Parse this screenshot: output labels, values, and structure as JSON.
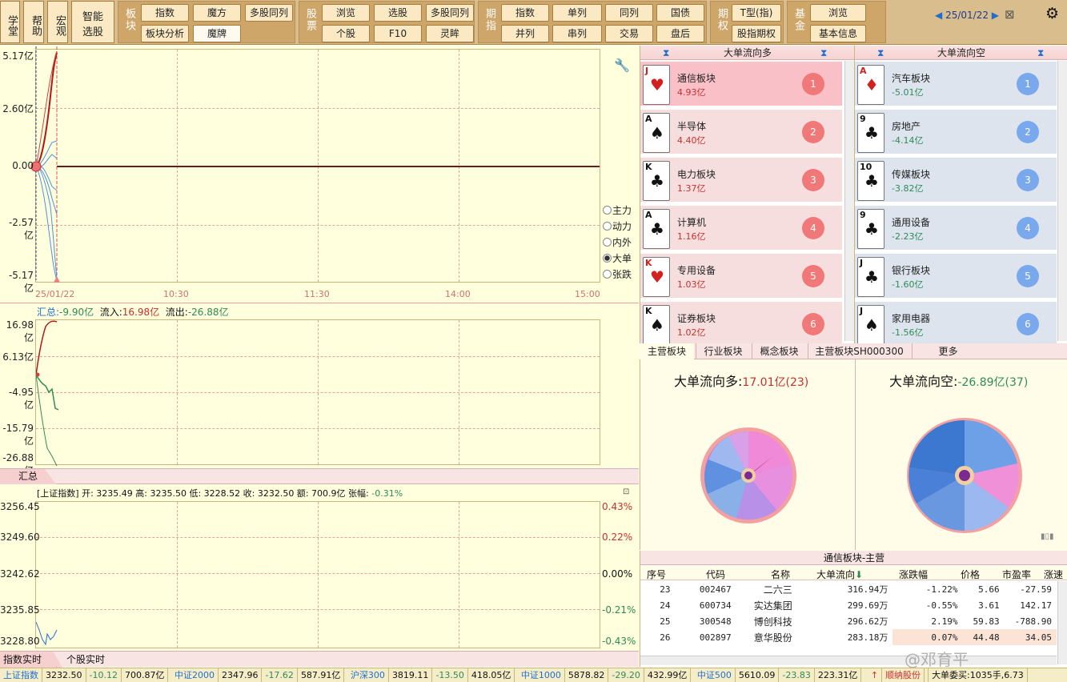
{
  "toolbar": {
    "left_buttons": [
      {
        "label": "学堂"
      },
      {
        "label": "帮助"
      },
      {
        "label": "宏观"
      },
      {
        "label": "智能选股"
      }
    ],
    "groups": {
      "bankuai": {
        "label": "板块",
        "buttons": [
          "指数",
          "魔方",
          "多股同列",
          "板块分析",
          "魔牌"
        ]
      },
      "gupiao": {
        "label": "股票",
        "buttons": [
          "浏览",
          "选股",
          "多股同列",
          "个股",
          "F10",
          "灵眸"
        ]
      },
      "qizhi": {
        "label": "期指",
        "buttons": [
          "指数",
          "单列",
          "同列",
          "国债",
          "并列",
          "串列",
          "交易",
          "盘后"
        ]
      },
      "qiquan": {
        "label": "期权",
        "buttons": [
          "T型(指)",
          "股指期权"
        ]
      },
      "jijin": {
        "label": "基金",
        "buttons": [
          "浏览",
          "基本信息"
        ]
      }
    },
    "date": "25/01/22"
  },
  "main_chart": {
    "y_labels": [
      "5.17亿",
      "2.60亿",
      "0.00",
      "-2.57亿",
      "-5.17亿"
    ],
    "x_labels": [
      "25/01/22",
      "10:30",
      "11:30",
      "14:00",
      "15:00"
    ],
    "radio_options": [
      "主力",
      "动力",
      "内外",
      "大单",
      "张跌"
    ],
    "selected_radio": "大单"
  },
  "flow_chart": {
    "summary_label": "汇总:",
    "summary_value": "-9.90亿",
    "inflow_label": "流入:",
    "inflow_value": "16.98亿",
    "outflow_label": "流出:",
    "outflow_value": "-26.88亿",
    "y_labels": [
      "16.98亿",
      "6.13亿",
      "-4.95亿",
      "-15.79亿",
      "-26.88亿"
    ],
    "tab_label": "汇总"
  },
  "index_chart": {
    "info": "[上证指数] 开: 3235.49  高: 3235.50  低: 3228.52  收: 3232.50  额: 700.9亿  张幅:",
    "change": "-0.31%",
    "y_left": [
      "3256.45",
      "3249.60",
      "3242.62",
      "3235.85",
      "3228.80"
    ],
    "y_right": [
      "0.43%",
      "0.22%",
      "0.00%",
      "-0.21%",
      "-0.43%"
    ],
    "tabs": [
      "指数实时",
      "个股实时"
    ]
  },
  "inflow_list": {
    "title": "大单流向多",
    "items": [
      {
        "rank": "J",
        "suit": "♥",
        "name": "通信板块",
        "value": "4.93亿",
        "num": "1"
      },
      {
        "rank": "A",
        "suit": "♠",
        "name": "半导体",
        "value": "4.40亿",
        "num": "2"
      },
      {
        "rank": "K",
        "suit": "♣",
        "name": "电力板块",
        "value": "1.37亿",
        "num": "3"
      },
      {
        "rank": "A",
        "suit": "♣",
        "name": "计算机",
        "value": "1.16亿",
        "num": "4"
      },
      {
        "rank": "K",
        "suit": "♥",
        "name": "专用设备",
        "value": "1.03亿",
        "num": "5"
      },
      {
        "rank": "K",
        "suit": "♠",
        "name": "证券板块",
        "value": "1.02亿",
        "num": "6"
      }
    ]
  },
  "outflow_list": {
    "title": "大单流向空",
    "items": [
      {
        "rank": "A",
        "suit": "♦",
        "name": "汽车板块",
        "value": "-5.01亿",
        "num": "1"
      },
      {
        "rank": "9",
        "suit": "♣",
        "name": "房地产",
        "value": "-4.14亿",
        "num": "2"
      },
      {
        "rank": "10",
        "suit": "♣",
        "name": "传媒板块",
        "value": "-3.82亿",
        "num": "3"
      },
      {
        "rank": "9",
        "suit": "♣",
        "name": "通用设备",
        "value": "-2.23亿",
        "num": "4"
      },
      {
        "rank": "J",
        "suit": "♣",
        "name": "银行板块",
        "value": "-1.60亿",
        "num": "5"
      },
      {
        "rank": "J",
        "suit": "♠",
        "name": "家用电器",
        "value": "-1.56亿",
        "num": "6"
      }
    ]
  },
  "sector_tabs": [
    "主营板块",
    "行业板块",
    "概念板块",
    "主营板块SH000300",
    "更多"
  ],
  "pie": {
    "left_title": "大单流向多:",
    "left_value": "17.01亿(23)",
    "right_title": "大单流向空:",
    "right_value": "-26.89亿(37)"
  },
  "stock_table": {
    "title": "通信板块-主营",
    "headers": [
      "序号",
      "代码",
      "名称",
      "大单流向",
      "涨跌幅",
      "价格",
      "市盈率",
      "涨速"
    ],
    "rows": [
      [
        "23",
        "002467",
        "二六三",
        "316.94万",
        "-1.22%",
        "5.66",
        "-27.59"
      ],
      [
        "24",
        "600734",
        "实达集团",
        "299.69万",
        "-0.55%",
        "3.61",
        "142.17"
      ],
      [
        "25",
        "300548",
        "博创科技",
        "296.62万",
        "2.19%",
        "59.83",
        "-788.90"
      ],
      [
        "26",
        "002897",
        "意华股份",
        "283.18万",
        "0.07%",
        "44.48",
        "34.05"
      ]
    ]
  },
  "status_bar": [
    "上证指数",
    "3232.50",
    "-10.12",
    "700.87亿",
    "中证2000",
    "2347.96",
    "-17.62",
    "587.91亿",
    "沪深300",
    "3819.11",
    "-13.50",
    "418.05亿",
    "中证1000",
    "5878.82",
    "-29.20",
    "432.99亿",
    "中证500",
    "5610.09",
    "-23.83",
    "223.31亿",
    "顺纳股份",
    "大单委买:1035手,6.73"
  ],
  "watermark": "@邓育平"
}
